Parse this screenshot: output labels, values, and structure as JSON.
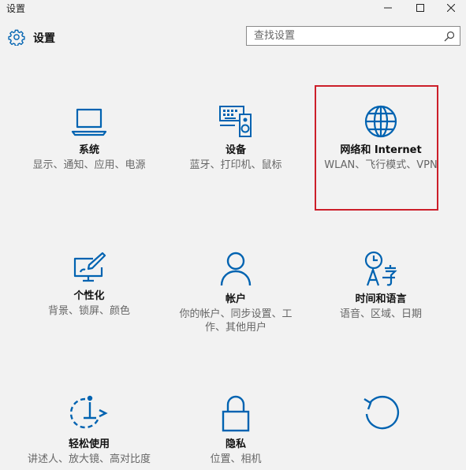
{
  "window": {
    "title": "设置",
    "controls": [
      "minimize",
      "maximize",
      "close"
    ]
  },
  "header": {
    "icon": "gear-icon",
    "title": "设置"
  },
  "search": {
    "placeholder": "查找设置",
    "icon": "search-icon"
  },
  "colors": {
    "accent": "#0063b1",
    "highlight": "#cc1f2a",
    "background": "#f2f2f2"
  },
  "tiles": [
    {
      "icon": "laptop-icon",
      "label": "系统",
      "desc": "显示、通知、应用、电源"
    },
    {
      "icon": "devices-icon",
      "label": "设备",
      "desc": "蓝牙、打印机、鼠标"
    },
    {
      "icon": "globe-icon",
      "label": "网络和 Internet",
      "desc": "WLAN、飞行模式、VPN"
    },
    {
      "icon": "personalization-icon",
      "label": "个性化",
      "desc": "背景、锁屏、颜色"
    },
    {
      "icon": "account-icon",
      "label": "帐户",
      "desc": "你的帐户、同步设置、工作、其他用户"
    },
    {
      "icon": "time-language-icon",
      "label": "时间和语言",
      "desc": "语音、区域、日期"
    },
    {
      "icon": "ease-of-access-icon",
      "label": "轻松使用",
      "desc": "讲述人、放大镜、高对比度"
    },
    {
      "icon": "lock-icon",
      "label": "隐私",
      "desc": "位置、相机"
    },
    {
      "icon": "update-icon",
      "label": "",
      "desc": ""
    }
  ]
}
